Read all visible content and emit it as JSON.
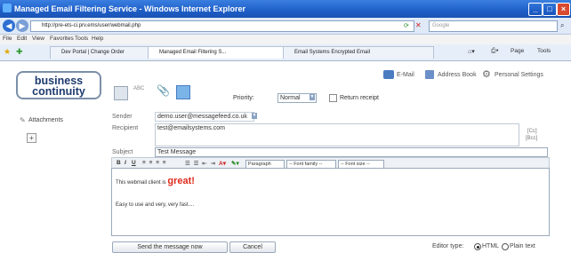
{
  "window": {
    "title": "Managed Email Filtering Service - Windows Internet Explorer",
    "url": "http://pre-ets-ci.prv.ems/user/webmail.php",
    "search_placeholder": "Google"
  },
  "menu": [
    "File",
    "Edit",
    "View",
    "Favorites",
    "Tools",
    "Help"
  ],
  "tabs": [
    {
      "label": "Dev Portal | Change Order",
      "active": false
    },
    {
      "label": "Managed Email Filtering S...",
      "active": true
    },
    {
      "label": "Email Systems Encrypted Email",
      "active": false
    }
  ],
  "ie_toolbar": {
    "page_label": "Page",
    "tools_label": "Tools"
  },
  "logo": {
    "line1": "business",
    "line2": "continuity"
  },
  "top_links": {
    "email": "E-Mail",
    "address_book": "Address Book",
    "personal_settings": "Personal Settings"
  },
  "compose": {
    "priority_label": "Priority:",
    "priority_value": "Normal",
    "return_receipt_label": "Return receipt",
    "attachments_label": "Attachments",
    "attach_add": "+",
    "sender_label": "Sender",
    "sender_value": "demo.user@messagefeed.co.uk",
    "recipient_label": "Recipient",
    "recipient_value": "test@emailsystems.com",
    "cc_label": "[Cc]",
    "bcc_label": "[Bcc]",
    "subject_label": "Subject",
    "subject_value": "Test Message"
  },
  "editor": {
    "paragraph_select": "Paragraph",
    "font_family_select": "-- Font family --",
    "font_size_select": "-- Font size --",
    "line1_prefix": "This webmail client is ",
    "line1_emphasis": "great!",
    "line2": "Easy to use and very, very fast...."
  },
  "footer": {
    "send_button": "Send the message now",
    "cancel_button": "Cancel",
    "editor_type_label": "Editor type:",
    "html_option": "HTML",
    "plain_option": "Plain text",
    "selected": "HTML"
  },
  "colors": {
    "accent": "#1f5fc8",
    "logo_text": "#1e3a6e",
    "emphasis": "#e02a1b"
  }
}
